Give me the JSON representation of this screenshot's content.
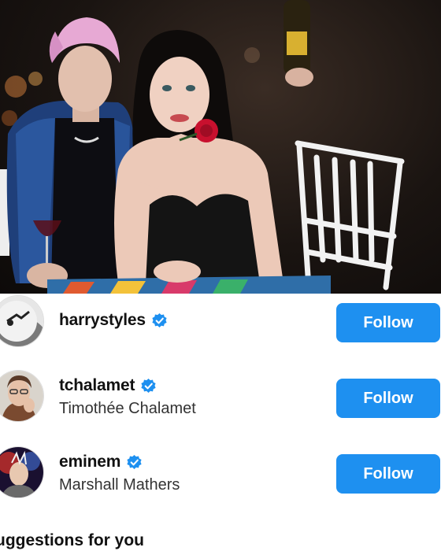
{
  "photo": {
    "subject": "couple seated at a party table, woman holding a red rose"
  },
  "suggestions": [
    {
      "username": "harrystyles",
      "full_name": "",
      "verified": true,
      "avatar_icon": "profile-photo-harrystyles",
      "follow_label": "Follow"
    },
    {
      "username": "tchalamet",
      "full_name": "Timothée Chalamet",
      "verified": true,
      "avatar_icon": "profile-photo-tchalamet",
      "follow_label": "Follow"
    },
    {
      "username": "eminem",
      "full_name": "Marshall Mathers",
      "verified": true,
      "avatar_icon": "profile-photo-eminem",
      "follow_label": "Follow"
    }
  ],
  "section_title": "uggestions for you",
  "colors": {
    "follow_button": "#1e90f0",
    "verified_badge": "#1e90f0",
    "text": "#111111"
  }
}
